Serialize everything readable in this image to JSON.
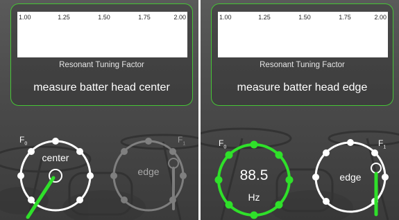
{
  "meter": {
    "ticks": [
      "1.00",
      "1.25",
      "1.50",
      "1.75",
      "2.00"
    ],
    "caption": "Resonant Tuning Factor"
  },
  "left_screen": {
    "instruction": "measure batter head center",
    "f0_label": "F",
    "f0_sub": "0",
    "f1_label": "F",
    "f1_sub": "1",
    "center_dial_label": "center",
    "edge_dial_label": "edge"
  },
  "right_screen": {
    "instruction": "measure batter head edge",
    "f0_label": "F",
    "f0_sub": "0",
    "f1_label": "F",
    "f1_sub": "1",
    "frequency_value": "88.5",
    "frequency_unit": "Hz",
    "edge_dial_label": "edge"
  },
  "colors": {
    "accent_green": "#46c636",
    "active_green": "#2fe02a",
    "dial_white": "#ffffff",
    "inactive_gray": "#8c8c8c"
  }
}
